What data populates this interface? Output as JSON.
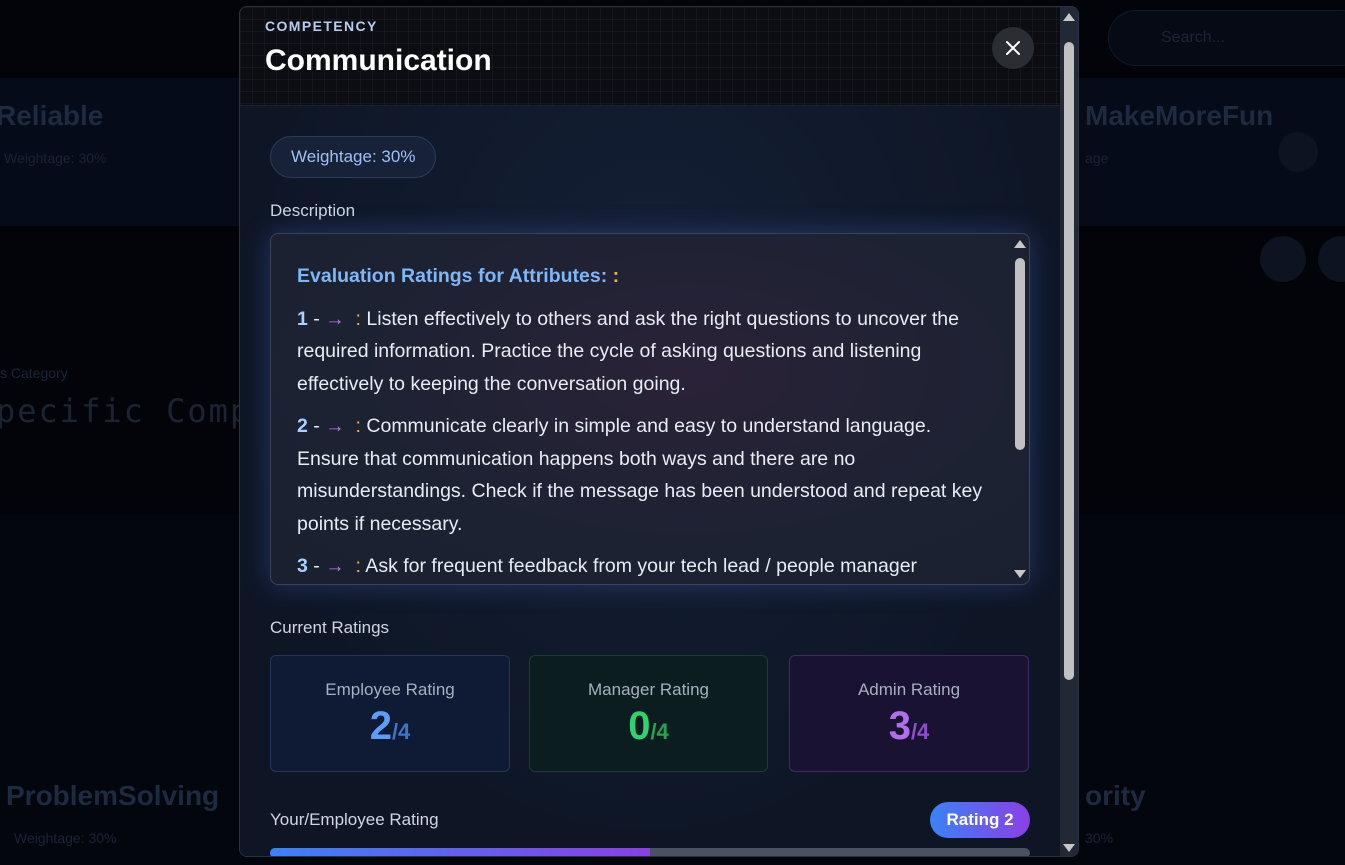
{
  "background": {
    "card_top_left_title": "Reliable",
    "card_top_left_sub": "Weightage: 30%",
    "card_top_right_title": "MakeMoreFun",
    "card_top_right_sub": "age",
    "section_label": "s Category",
    "mono_heading": "pecific Comp",
    "bottom_left_title": "ProblemSolving",
    "bottom_left_sub": "Weightage: 30%",
    "bottom_right_title": "ority",
    "bottom_right_sub": "30%",
    "search_placeholder": "Search..."
  },
  "modal": {
    "eyebrow": "COMPETENCY",
    "title": "Communication",
    "close_glyph": "✕",
    "weightage": "Weightage: 30%",
    "description_label": "Description",
    "description": {
      "heading": "Evaluation Ratings for Attributes:",
      "heading_colon": ":",
      "items": [
        {
          "num": "1",
          "dash": " - ",
          "arrow": "→",
          "colon": ":",
          "text": " Listen effectively to others and ask the right questions to uncover the required information. Practice the cycle of asking questions and listening effectively to keeping the conversation going."
        },
        {
          "num": "2",
          "dash": " - ",
          "arrow": "→",
          "colon": ":",
          "text": " Communicate clearly in simple and easy to understand language. Ensure that communication happens both ways and there are no misunderstandings. Check if the message has been understood and repeat key points if necessary."
        },
        {
          "num": "3",
          "dash": " - ",
          "arrow": "→",
          "colon": ":",
          "text": " Ask for frequent feedback from your tech lead / people manager"
        }
      ]
    },
    "current_ratings_label": "Current Ratings",
    "ratings": [
      {
        "label": "Employee Rating",
        "value": "2",
        "denominator": "/4"
      },
      {
        "label": "Manager Rating",
        "value": "0",
        "denominator": "/4"
      },
      {
        "label": "Admin Rating",
        "value": "3",
        "denominator": "/4"
      }
    ],
    "your_rating_label": "Your/Employee Rating",
    "rating_badge": "Rating 2",
    "progress": 0.5
  }
}
